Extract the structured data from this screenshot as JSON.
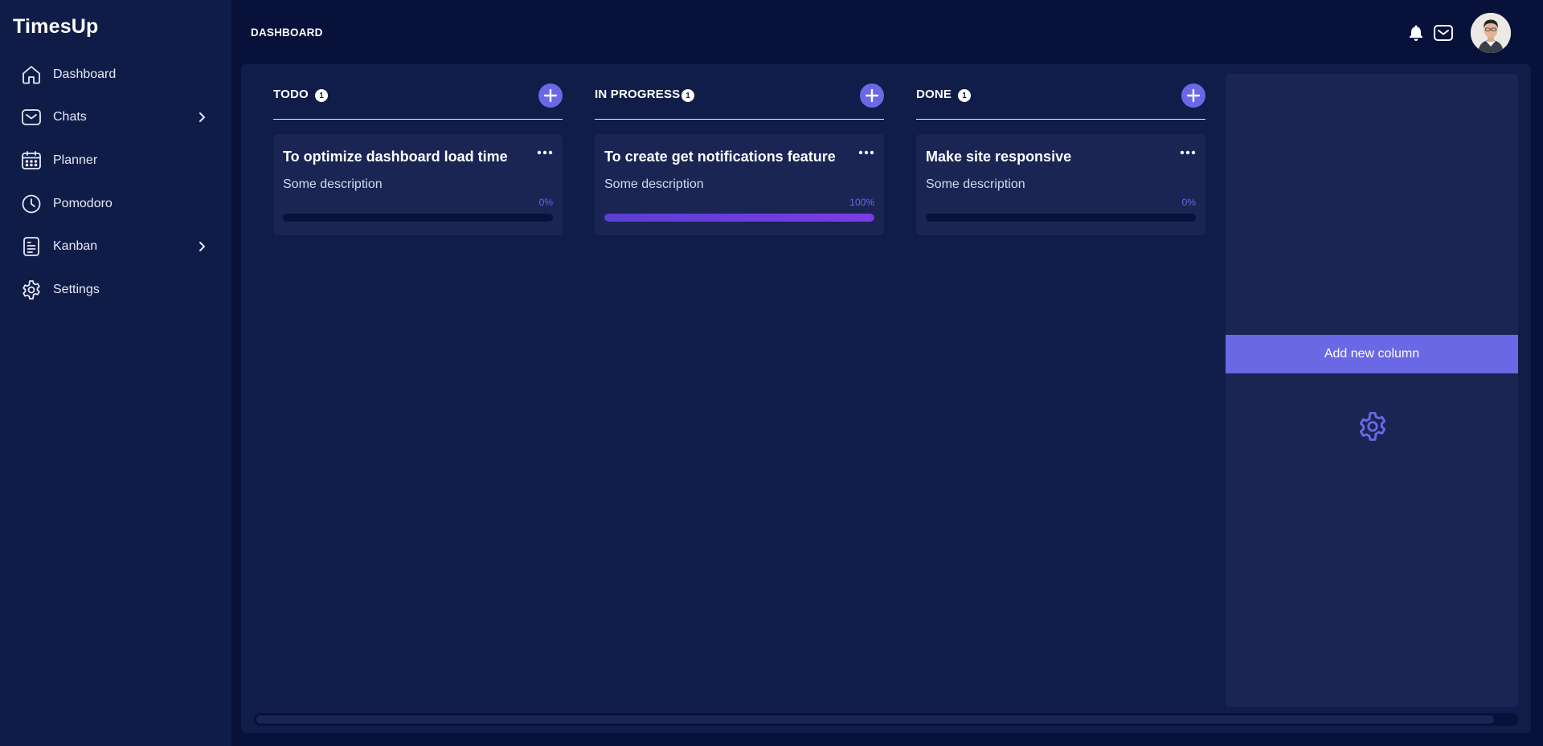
{
  "app": {
    "name": "TimesUp"
  },
  "sidebar": {
    "items": [
      {
        "label": "Dashboard",
        "icon": "home-icon",
        "has_submenu": false
      },
      {
        "label": "Chats",
        "icon": "mail-icon",
        "has_submenu": true
      },
      {
        "label": "Planner",
        "icon": "calendar-icon",
        "has_submenu": false
      },
      {
        "label": "Pomodoro",
        "icon": "clock-icon",
        "has_submenu": false
      },
      {
        "label": "Kanban",
        "icon": "document-icon",
        "has_submenu": true
      },
      {
        "label": "Settings",
        "icon": "gear-icon",
        "has_submenu": false
      }
    ]
  },
  "header": {
    "title": "DASHBOARD",
    "icons": [
      "bell-icon",
      "mail-icon",
      "avatar"
    ]
  },
  "board": {
    "columns": [
      {
        "title": "TODO",
        "count": "1",
        "cards": [
          {
            "title": "To optimize dashboard load time",
            "description": "Some description",
            "progress": 0,
            "progress_label": "0%"
          }
        ]
      },
      {
        "title": "IN PROGRESS",
        "count": "1",
        "cards": [
          {
            "title": "To create get notifications feature",
            "description": "Some description",
            "progress": 100,
            "progress_label": "100%"
          }
        ]
      },
      {
        "title": "DONE",
        "count": "1",
        "cards": [
          {
            "title": "Make site responsive",
            "description": "Some description",
            "progress": 0,
            "progress_label": "0%"
          }
        ]
      }
    ],
    "add_column_label": "Add new column"
  },
  "colors": {
    "background": "#07113a",
    "sidebar": "#101c48",
    "panel": "#101d48",
    "card": "#1a2554",
    "accent": "#6b68e6",
    "progress_gradient_start": "#5a3fd4",
    "progress_gradient_end": "#7d3be6"
  }
}
